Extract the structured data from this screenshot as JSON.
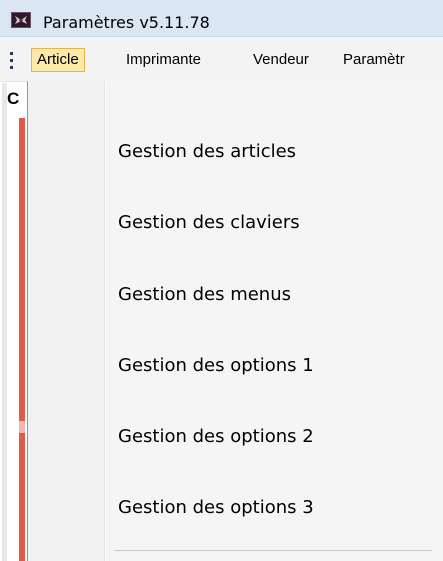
{
  "window": {
    "title": "Paramètres v5.11.78",
    "icon": "app-icon"
  },
  "menubar": {
    "items": [
      {
        "label": "Article",
        "active": true
      },
      {
        "label": "Imprimante",
        "active": false
      },
      {
        "label": "Vendeur",
        "active": false
      },
      {
        "label": "Paramètr",
        "active": false
      }
    ]
  },
  "panel": {
    "header_letter": "C",
    "accent_color": "#e05a4a"
  },
  "dropdown": {
    "items": [
      {
        "label": "Gestion des articles"
      },
      {
        "label": "Gestion des claviers"
      },
      {
        "label": "Gestion des menus"
      },
      {
        "label": "Gestion des options 1"
      },
      {
        "label": "Gestion des options 2"
      },
      {
        "label": "Gestion des options 3"
      }
    ]
  },
  "colors": {
    "titlebar": "#dbe6f3",
    "menu_active_bg": "#fde9a8",
    "menu_active_border": "#e2b352",
    "dropdown_bg": "#f5f5f5"
  }
}
